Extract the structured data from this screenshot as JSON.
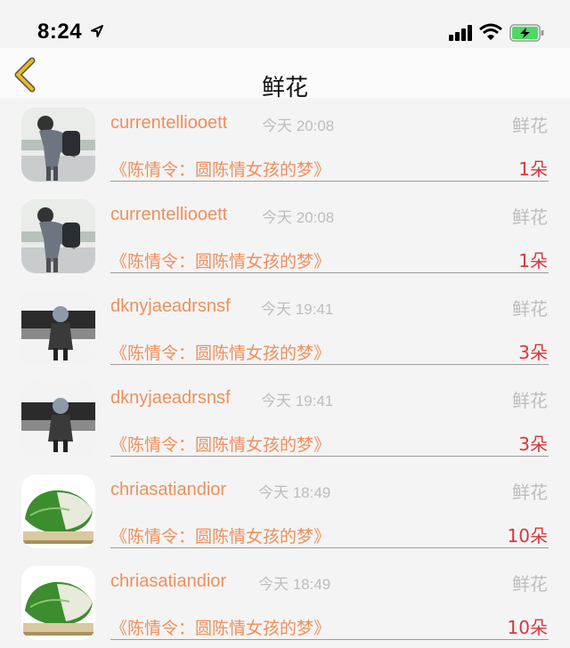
{
  "status_bar": {
    "time": "8:24",
    "icons": [
      "location-arrow-icon",
      "signal-icon",
      "wifi-icon",
      "battery-charging-icon"
    ],
    "battery_color": "#4cd964"
  },
  "nav": {
    "title": "鲜花",
    "back_icon": "chevron-left-icon",
    "back_icon_color": "#e8b923"
  },
  "colors": {
    "username": "#ef8f5c",
    "book_title": "#ef8f5c",
    "count": "#d9363e",
    "muted": "#bdbdbd"
  },
  "records": [
    {
      "username": "currentellioo​ett",
      "time": "今天 20:08",
      "type": "鲜花",
      "book": "《陈情令：圆陈情女孩的梦》",
      "count": "1朵",
      "avatar": "person-photo"
    },
    {
      "username": "currentellioo​ett",
      "time": "今天 20:08",
      "type": "鲜花",
      "book": "《陈情令：圆陈情女孩的梦》",
      "count": "1朵",
      "avatar": "person-photo"
    },
    {
      "username": "dknyjaeadrsnsf",
      "time": "今天 19:41",
      "type": "鲜花",
      "book": "《陈情令：圆陈情女孩的梦》",
      "count": "3朵",
      "avatar": "ink-figure"
    },
    {
      "username": "dknyjaeadrsnsf",
      "time": "今天 19:41",
      "type": "鲜花",
      "book": "《陈情令：圆陈情女孩的梦》",
      "count": "3朵",
      "avatar": "ink-figure"
    },
    {
      "username": "chriasatiandior",
      "time": "今天 18:49",
      "type": "鲜花",
      "book": "《陈情令：圆陈情女孩的梦》",
      "count": "10朵",
      "avatar": "cabbage"
    },
    {
      "username": "chriasatiandior",
      "time": "今天 18:49",
      "type": "鲜花",
      "book": "《陈情令：圆陈情女孩的梦》",
      "count": "10朵",
      "avatar": "cabbage"
    }
  ]
}
